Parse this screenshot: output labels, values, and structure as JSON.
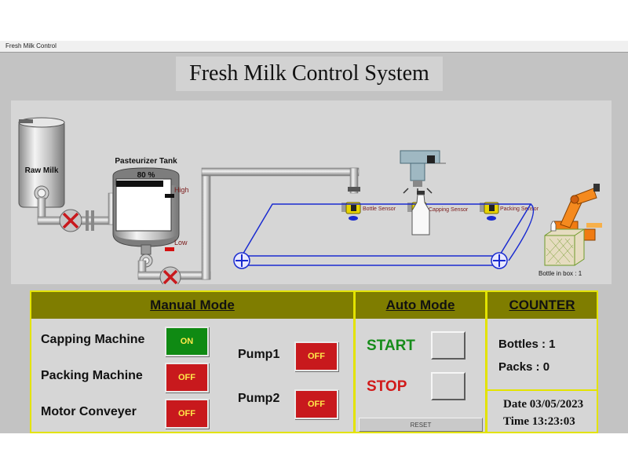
{
  "window": {
    "title": "Fresh Milk Control"
  },
  "header": {
    "title": "Fresh Milk Control System"
  },
  "scene": {
    "raw_milk_label": "Raw Milk",
    "tank_label": "Pasteurizer Tank",
    "tank_level": "80 %",
    "tank_level_fraction": 0.8,
    "high_label": "High",
    "low_label": "Low",
    "bottle_sensor": "Bottle Sensor",
    "capping_sensor": "Capping Sensor",
    "packing_sensor": "Packing Sensor",
    "bottle_in_box": "Bottle in box : 1",
    "colors": {
      "sensor": "#e8d400",
      "valve": "#c8191d",
      "conveyor": "#1a2bd0",
      "robot": "#f07b12"
    }
  },
  "manual": {
    "title": "Manual Mode",
    "capping_label": "Capping Machine",
    "capping_state": "ON",
    "packing_label": "Packing Machine",
    "packing_state": "OFF",
    "motor_label": "Motor Conveyer",
    "motor_state": "OFF",
    "pump1_label": "Pump1",
    "pump1_state": "OFF",
    "pump2_label": "Pump2",
    "pump2_state": "OFF"
  },
  "auto": {
    "title": "Auto Mode",
    "start_label": "START",
    "stop_label": "STOP",
    "reset_label": "RESET",
    "colors": {
      "start": "#168c1a",
      "stop": "#d11a1a"
    }
  },
  "counter": {
    "title": "COUNTER",
    "bottles": "Bottles : 1",
    "packs": "Packs : 0",
    "date": "Date 03/05/2023",
    "time": "Time  13:23:03"
  }
}
